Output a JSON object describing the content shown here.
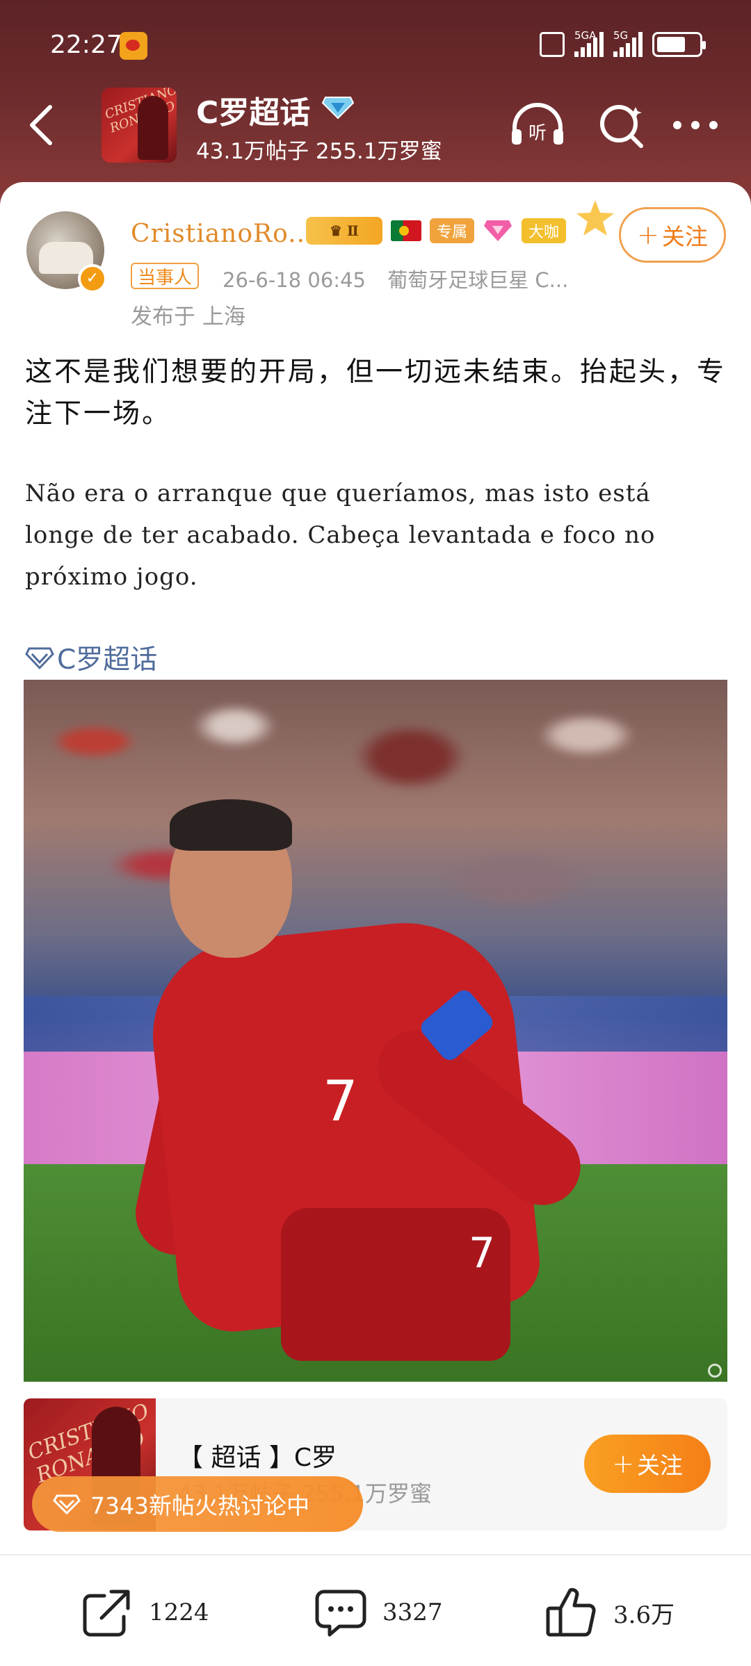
{
  "status_bar": {
    "time": "22:27",
    "signal_1_label": "5GA",
    "signal_2_label": "5G"
  },
  "header": {
    "topic_title": "C罗超话",
    "topic_stats": "43.1万帖子 255.1万罗蜜",
    "listen_label": "听",
    "avatar_lettering": "CRISTIANO RONALDO"
  },
  "post": {
    "author_name": "CristianoRo...",
    "level_badge": "Ⅱ",
    "tag_exclusive": "专属",
    "tag_bigshot": "大咖",
    "source_tag": "当事人",
    "timestamp": "26-6-18 06:45",
    "author_desc": "葡萄牙足球巨星 C...",
    "location": "发布于 上海",
    "follow_label": "关注",
    "super_label": "超",
    "content_zh": "这不是我们想要的开局，但一切远未结束。抬起头，专注下一场。",
    "content_pt": "Não era o arranque que queríamos, mas isto está longe de ter acabado. Cabeça levantada e foco no próximo jogo.",
    "topic_link": "C罗超话"
  },
  "topic_card": {
    "title": "【 超话 】C罗",
    "stats": "43.1万帖子 255.1万罗蜜",
    "follow_label": "关注",
    "hot_label": "7343新帖火热讨论中"
  },
  "actions": {
    "repost_count": "1224",
    "comment_count": "3327",
    "like_count": "3.6万"
  },
  "colors": {
    "header_bg": "#6b2a2c",
    "accent_orange": "#f57f17",
    "author_name": "#e08a2a",
    "topic_link": "#506c9c",
    "meta_gray": "#9a9a9a"
  }
}
